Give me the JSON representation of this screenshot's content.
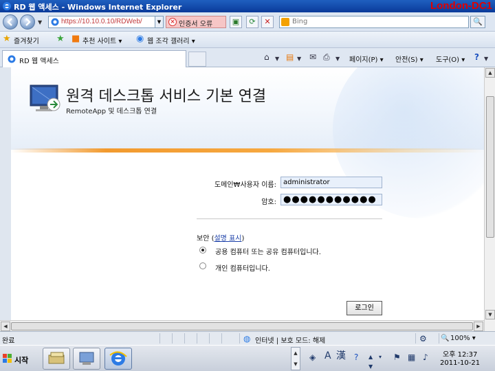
{
  "window": {
    "title": "RD 웹 액세스 - Windows Internet Explorer",
    "server_label": "London-DC1"
  },
  "address_bar": {
    "url": "https://10.10.0.10/RDWeb/",
    "cert_error": "인증서 오류",
    "search_placeholder": "Bing"
  },
  "favorites_bar": {
    "favorites": "즐겨찾기",
    "suggested_sites": "추천 사이트 ▾",
    "web_slice_gallery": "웹 조각 갤러리 ▾"
  },
  "tabs": [
    {
      "label": "RD 웹 액세스"
    }
  ],
  "command_bar": {
    "page": "페이지(P) ▾",
    "safety": "안전(S) ▾",
    "tools": "도구(O) ▾"
  },
  "page": {
    "title": "원격 데스크톱 서비스 기본 연결",
    "subtitle": "RemoteApp 및 데스크톱 연결",
    "username_label": "도메인₩사용자 이름:",
    "username_value": "administrator",
    "password_label": "암호:",
    "password_mask": "●●●●●●●●●●●",
    "security_label": "보안 (",
    "security_link": "설명 표시",
    "security_close": ")",
    "options": [
      {
        "label": "공용 컴퓨터 또는 공유 컴퓨터입니다.",
        "checked": true
      },
      {
        "label": "개인 컴퓨터입니다.",
        "checked": false
      }
    ],
    "login_button": "로그인"
  },
  "status_bar": {
    "status": "완료",
    "zone": "인터넷 | 보호 모드: 해제",
    "zoom": "100% ▾"
  },
  "taskbar": {
    "start_label": "시작",
    "clock_time": "오후 12:37",
    "clock_date": "2011-10-21"
  },
  "colors": {
    "accent_orange": "#f29a2e",
    "title_bar_blue": "#1f5fbf",
    "server_label_red": "#e00000",
    "cert_error_bg": "#f6c6c6"
  }
}
